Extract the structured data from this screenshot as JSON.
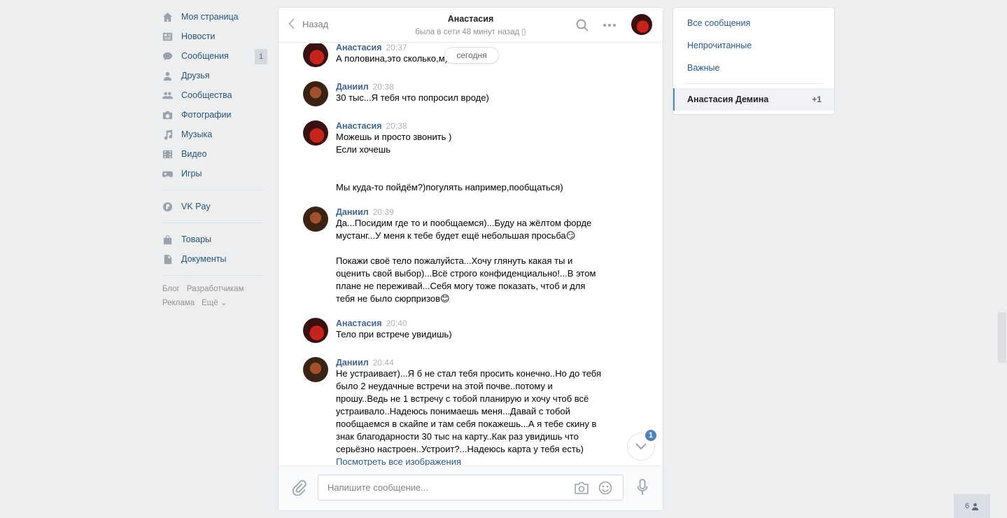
{
  "leftnav": {
    "items": [
      {
        "label": "Моя страница",
        "icon": "home-icon"
      },
      {
        "label": "Новости",
        "icon": "news-icon"
      },
      {
        "label": "Сообщения",
        "icon": "messages-icon",
        "badge": "1"
      },
      {
        "label": "Друзья",
        "icon": "friends-icon"
      },
      {
        "label": "Сообщества",
        "icon": "groups-icon"
      },
      {
        "label": "Фотографии",
        "icon": "camera-icon"
      },
      {
        "label": "Музыка",
        "icon": "music-icon"
      },
      {
        "label": "Видео",
        "icon": "video-icon"
      },
      {
        "label": "Игры",
        "icon": "games-icon"
      }
    ],
    "vkpay": "VK Pay",
    "goods": "Товары",
    "docs": "Документы",
    "footer": {
      "blog": "Блог",
      "dev": "Разработчикам",
      "ads": "Реклама",
      "more": "Ещё ⌄"
    }
  },
  "chat": {
    "back_label": "Назад",
    "peer_name": "Анастасия",
    "peer_status": "была в сети 48 минут назад",
    "date_pill": "сегодня",
    "messages": [
      {
        "author": "Анастасия",
        "time": "20:37",
        "lines": [
          "А половина,это сколько,м)"
        ]
      },
      {
        "author": "Даниил",
        "time": "20:38",
        "lines": [
          "30 тыс...Я тебя что попросил вроде)"
        ]
      },
      {
        "author": "Анастасия",
        "time": "20:38",
        "lines": [
          "Можешь и просто звонить )",
          "Если хочешь",
          "",
          "",
          "Мы куда-то пойдём?)погулять например,пообщаться)"
        ]
      },
      {
        "author": "Даниил",
        "time": "20:39",
        "lines": [
          "Да...Посидим где то и пообщаемся)...Буду на жёлтом форде",
          "мустанг...У меня к тебе будет ещё небольшая просьба😏",
          "",
          "Покажи своё тело пожалуйста...Хочу глянуть какая ты и",
          "оценить свой выбор)...Всё строго конфиденциально!...В этом",
          "плане не переживай...Себя могу тоже показать, чтоб и для",
          "тебя не было сюрпризов😊"
        ]
      },
      {
        "author": "Анастасия",
        "time": "20:40",
        "lines": [
          "Тело при встрече увидишь)"
        ]
      },
      {
        "author": "Даниил",
        "time": "20:44",
        "lines": [
          "Не устраивает)...Я б не стал тебя просить конечно..Но до тебя",
          "было 2 неудачные встречи на этой почве..потому и",
          "прошу..Ведь не 1 встречу с тобой планирую и хочу чтоб всё",
          "устраивало..Надеюсь понимаешь меня...Давай с тобой",
          "пообщаемся в скайпе и там себя покажешь...А я тебе скину в",
          "знак благодарности 30 тыс на карту..Как раз увидишь что",
          "серьёзно настроен..Устроит?...Надеюсь карта у тебя есть)"
        ],
        "link": "Посмотреть все изображения"
      }
    ],
    "unread_badge": "1",
    "composer": {
      "placeholder": "Напишите сообщение..."
    }
  },
  "rightpanel": {
    "all": "Все сообщения",
    "unread": "Непрочитанные",
    "important": "Важные",
    "active_name": "Анастасия Демина",
    "active_count": "+1"
  },
  "online_count": "6"
}
